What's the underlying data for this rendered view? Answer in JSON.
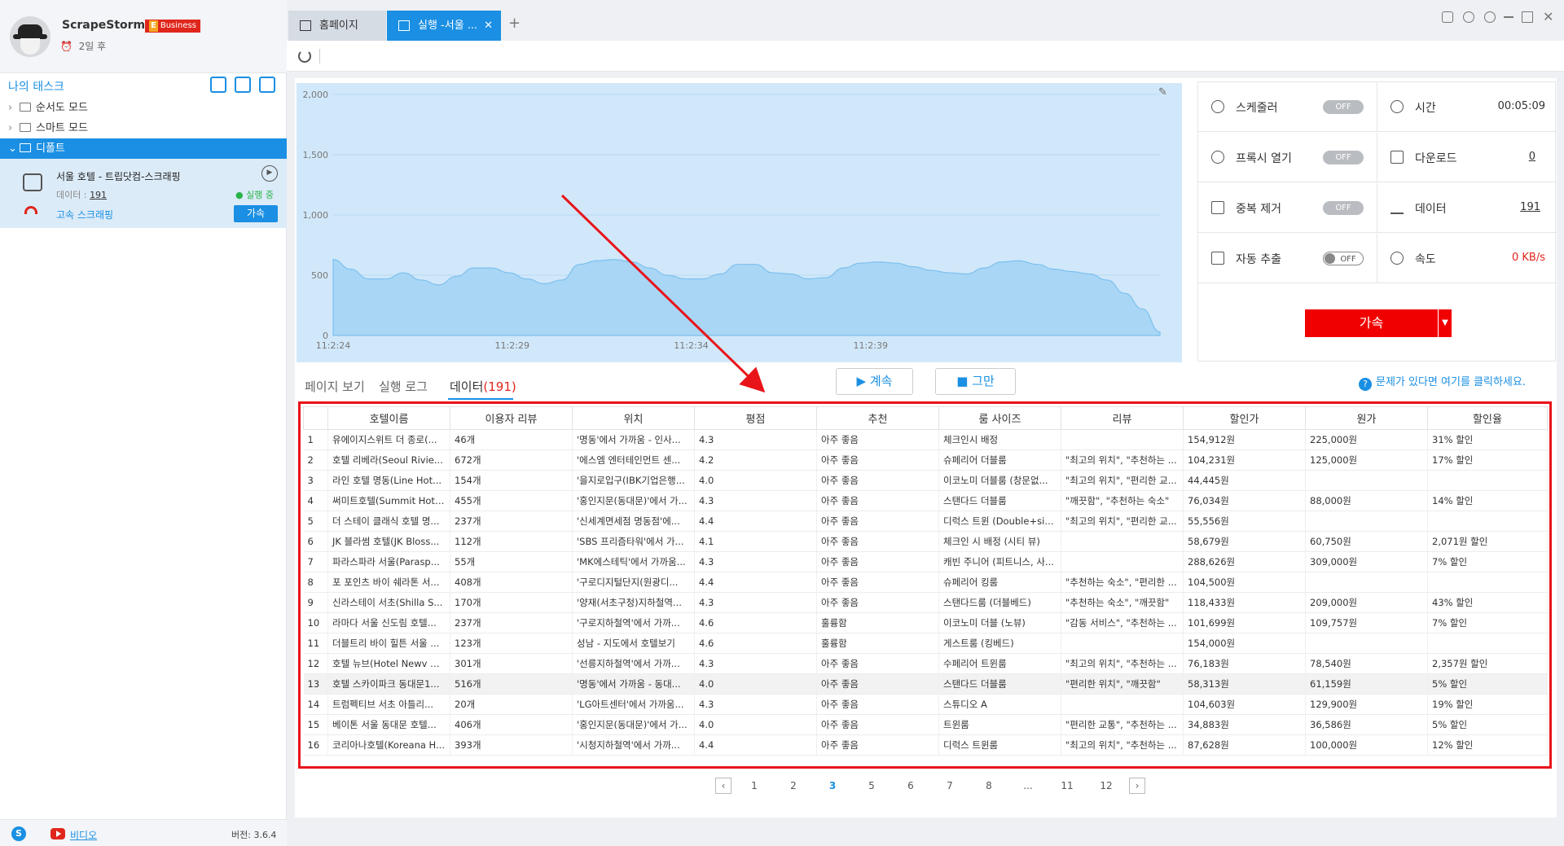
{
  "profile": {
    "name": "ScrapeStorm",
    "badge_letter": "E",
    "badge": "Business",
    "expire": "2일 후"
  },
  "sidebar": {
    "title": "나의 태스크",
    "folders": [
      {
        "label": "순서도 모드"
      },
      {
        "label": "스마트 모드"
      },
      {
        "label": "디폴트"
      }
    ],
    "task": {
      "title": "서울 호텔 - 트립닷컴-스크래핑",
      "data_label": "데이터 : ",
      "data_count": "191",
      "status": "실행 중",
      "speed_label": "고속 스크래핑",
      "accel": "가속"
    },
    "footer": {
      "video": "비디오",
      "version": "버전: 3.6.4"
    }
  },
  "tabs": [
    {
      "label": "홈페이지"
    },
    {
      "label": "실행 -서울 ..."
    }
  ],
  "chart_data": {
    "type": "area",
    "x_ticks": [
      "11:2:24",
      "11:2:29",
      "11:2:34",
      "11:2:39"
    ],
    "y_ticks": [
      "0",
      "500",
      "1,000",
      "1,500",
      "2,000"
    ],
    "ylim": [
      0,
      2000
    ],
    "values": [
      630,
      550,
      470,
      470,
      520,
      460,
      420,
      490,
      560,
      560,
      520,
      470,
      430,
      460,
      590,
      620,
      630,
      610,
      560,
      500,
      470,
      470,
      510,
      590,
      590,
      520,
      510,
      470,
      480,
      560,
      600,
      610,
      600,
      570,
      540,
      520,
      510,
      560,
      610,
      620,
      590,
      550,
      530,
      510,
      460,
      350,
      220,
      30
    ]
  },
  "stats": {
    "scheduler": {
      "label": "스케줄러",
      "toggle": "OFF"
    },
    "time": {
      "label": "시간",
      "value": "00:05:09"
    },
    "proxy": {
      "label": "프록시 열기",
      "toggle": "OFF"
    },
    "download": {
      "label": "다운로드",
      "value": "0"
    },
    "dedupe": {
      "label": "중복 제거",
      "toggle": "OFF"
    },
    "data": {
      "label": "데이터",
      "value": "191"
    },
    "auto_export": {
      "label": "자동 추출",
      "toggle": "OFF"
    },
    "speed": {
      "label": "속도",
      "value": "0 KB/s"
    },
    "accel": "가속"
  },
  "bottom_tabs": {
    "page_view": "페이지 보기",
    "run_log": "실행 로그",
    "data": "데이터",
    "data_count": "(191)"
  },
  "controls": {
    "continue": "계속",
    "stop": "그만"
  },
  "help": "문제가 있다면 여기를 클릭하세요.",
  "table": {
    "headers": [
      "",
      "호텔이름",
      "이용자 리뷰",
      "위치",
      "평점",
      "추천",
      "룸 사이즈",
      "리뷰",
      "할인가",
      "원가",
      "할인율"
    ],
    "rows": [
      [
        "1",
        "유에이지스위트 더 종로(...",
        "46개",
        "'명동'에서 가까움 - 인사...",
        "4.3",
        "아주 좋음",
        "체크인시 배정",
        "",
        "154,912원",
        "225,000원",
        "31% 할인"
      ],
      [
        "2",
        "호텔 리베라(Seoul Rivie...",
        "672개",
        "'에스엠 엔터테인먼트 센...",
        "4.2",
        "아주 좋음",
        "슈페리어 더블룸",
        "\"최고의 위치\", \"추천하는 ...",
        "104,231원",
        "125,000원",
        "17% 할인"
      ],
      [
        "3",
        "라인 호텔 명동(Line Hot...",
        "154개",
        "'을지로입구(IBK기업은행...",
        "4.0",
        "아주 좋음",
        "이코노미 더블룸 (창문없...",
        "\"최고의 위치\", \"편리한 교...",
        "44,445원",
        "",
        ""
      ],
      [
        "4",
        "써미트호텔(Summit Hote...",
        "455개",
        "'홍인지문(동대문)'에서 가...",
        "4.3",
        "아주 좋음",
        "스탠다드 더블룸",
        "\"깨끗함\", \"추천하는 숙소\"",
        "76,034원",
        "88,000원",
        "14% 할인"
      ],
      [
        "5",
        "더 스테이 클래식 호텔 명...",
        "237개",
        "'신세계면세점 명동점'에...",
        "4.4",
        "아주 좋음",
        "디럭스 트윈 (Double+sin...",
        "\"최고의 위치\", \"편리한 교...",
        "55,556원",
        "",
        ""
      ],
      [
        "6",
        "JK 블라썸 호텔(JK Bloss...",
        "112개",
        "'SBS 프리즘타워'에서 가...",
        "4.1",
        "아주 좋음",
        "체크인 시 배정 (시티 뷰)",
        "",
        "58,679원",
        "60,750원",
        "2,071원 할인"
      ],
      [
        "7",
        "파라스파라 서울(Parasp...",
        "55개",
        "'MK에스테틱'에서 가까움...",
        "4.3",
        "아주 좋음",
        "캐빈 주니어 (피트니스, 사...",
        "",
        "288,626원",
        "309,000원",
        "7% 할인"
      ],
      [
        "8",
        "포 포인츠 바이 쉐라톤 서...",
        "408개",
        "'구로디지털단지(원광디...",
        "4.4",
        "아주 좋음",
        "슈페리어 킹룸",
        "\"추천하는 숙소\", \"편리한 ...",
        "104,500원",
        "",
        ""
      ],
      [
        "9",
        "신라스테이 서초(Shilla S...",
        "170개",
        "'양재(서초구청)지하철역...",
        "4.3",
        "아주 좋음",
        "스탠다드룸 (더블베드)",
        "\"추천하는 숙소\", \"깨끗함\"",
        "118,433원",
        "209,000원",
        "43% 할인"
      ],
      [
        "10",
        "라마다 서울 신도림 호텔...",
        "237개",
        "'구로지하철역'에서 가까...",
        "4.6",
        "훌륭함",
        "이코노미 더블 (노뷰)",
        "\"감동 서비스\", \"추천하는 ...",
        "101,699원",
        "109,757원",
        "7% 할인"
      ],
      [
        "11",
        "더블트리 바이 힐튼 서울 ...",
        "123개",
        "성남 - 지도에서 호텔보기",
        "4.6",
        "훌륭함",
        "게스트룸 (킹베드)",
        "",
        "154,000원",
        "",
        ""
      ],
      [
        "12",
        "호텔 뉴브(Hotel Newv G...",
        "301개",
        "'선릉지하철역'에서 가까...",
        "4.3",
        "아주 좋음",
        "수페리어 트윈룸",
        "\"최고의 위치\", \"추천하는 ...",
        "76,183원",
        "78,540원",
        "2,357원 할인"
      ],
      [
        "13",
        "호텔 스카이파크 동대문1...",
        "516개",
        "'명동'에서 가까움 - 동대...",
        "4.0",
        "아주 좋음",
        "스탠다드 더블룸",
        "\"편리한 위치\", \"깨끗함\"",
        "58,313원",
        "61,159원",
        "5% 할인"
      ],
      [
        "14",
        "트럼펙티브 서초 아틀리...",
        "20개",
        "'LG아트센터'에서 가까움...",
        "4.3",
        "아주 좋음",
        "스튜디오 A",
        "",
        "104,603원",
        "129,900원",
        "19% 할인"
      ],
      [
        "15",
        "베이톤 서울 동대문 호텔...",
        "406개",
        "'홍인지문(동대문)'에서 가...",
        "4.0",
        "아주 좋음",
        "트윈룸",
        "\"편리한 교통\", \"추천하는 ...",
        "34,883원",
        "36,586원",
        "5% 할인"
      ],
      [
        "16",
        "코리아나호텔(Koreana H...",
        "393개",
        "'시청지하철역'에서 가까...",
        "4.4",
        "아주 좋음",
        "디럭스 트윈룸",
        "\"최고의 위치\", \"추천하는 ...",
        "87,628원",
        "100,000원",
        "12% 할인"
      ]
    ]
  },
  "pager": [
    "1",
    "2",
    "3",
    "5",
    "6",
    "7",
    "8",
    "...",
    "11",
    "12"
  ],
  "colors": {
    "accent": "#1a8fe3",
    "danger": "#e8141a",
    "chart_fill": "#a9d6f5"
  }
}
